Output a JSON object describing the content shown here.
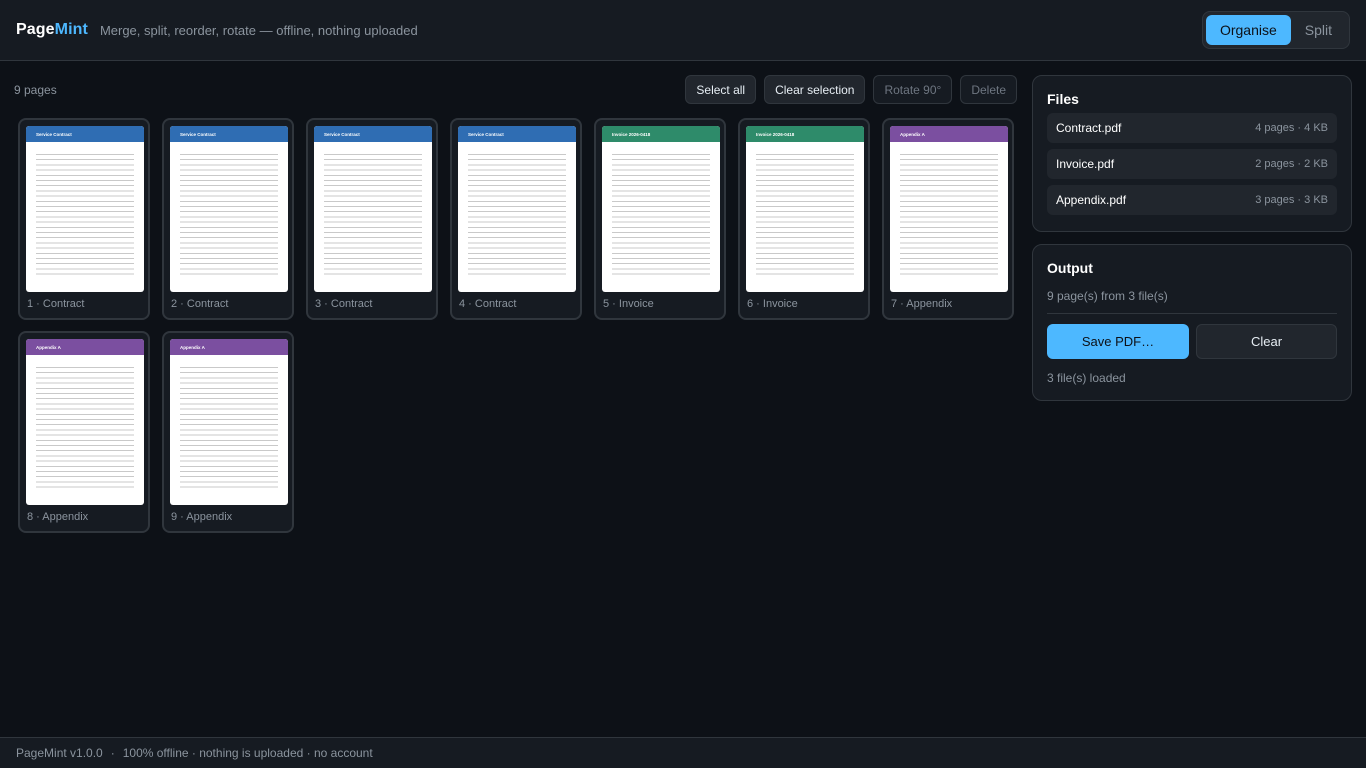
{
  "app": {
    "name_part1": "Page",
    "name_part2": "Mint",
    "tagline": "Merge, split, reorder, rotate — offline, nothing uploaded",
    "brand_color": "#4db8ff"
  },
  "modes": [
    {
      "label": "Organise",
      "active": true
    },
    {
      "label": "Split",
      "active": false
    }
  ],
  "toolbar": {
    "page_count": "9 pages",
    "select_all": "Select all",
    "clear_selection": "Clear selection",
    "rotate": "Rotate 90°",
    "delete": "Delete"
  },
  "pages": [
    {
      "label": "1 · Contract",
      "thumb_title": "Service Contract",
      "color": "#2f6db3"
    },
    {
      "label": "2 · Contract",
      "thumb_title": "Service Contract",
      "color": "#2f6db3"
    },
    {
      "label": "3 · Contract",
      "thumb_title": "Service Contract",
      "color": "#2f6db3"
    },
    {
      "label": "4 · Contract",
      "thumb_title": "Service Contract",
      "color": "#2f6db3"
    },
    {
      "label": "5 · Invoice",
      "thumb_title": "Invoice 2026-0418",
      "color": "#2e8b6a"
    },
    {
      "label": "6 · Invoice",
      "thumb_title": "Invoice 2026-0418",
      "color": "#2e8b6a"
    },
    {
      "label": "7 · Appendix",
      "thumb_title": "Appendix A",
      "color": "#7b4fa0"
    },
    {
      "label": "8 · Appendix",
      "thumb_title": "Appendix A",
      "color": "#7b4fa0"
    },
    {
      "label": "9 · Appendix",
      "thumb_title": "Appendix A",
      "color": "#7b4fa0"
    }
  ],
  "files": {
    "title": "Files",
    "items": [
      {
        "name": "Contract.pdf",
        "meta": "4 pages · 4 KB"
      },
      {
        "name": "Invoice.pdf",
        "meta": "2 pages · 2 KB"
      },
      {
        "name": "Appendix.pdf",
        "meta": "3 pages · 3 KB"
      }
    ]
  },
  "output": {
    "title": "Output",
    "summary": "9 page(s) from 3 file(s)",
    "save_label": "Save PDF…",
    "clear_label": "Clear",
    "status": "3 file(s) loaded"
  },
  "footer": {
    "version": "PageMint v1.0.0",
    "separator": "·",
    "note": "100% offline · nothing is uploaded · no account"
  }
}
